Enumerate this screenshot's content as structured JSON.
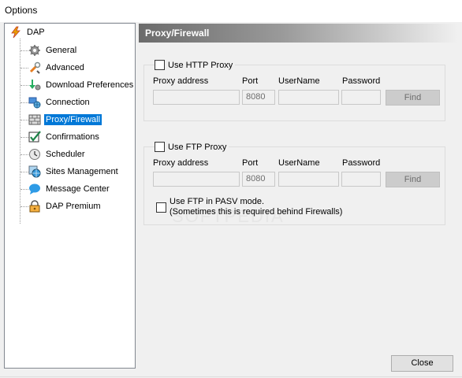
{
  "window": {
    "title": "Options"
  },
  "tree": {
    "root": {
      "label": "DAP",
      "icon": "dap-bolt-icon"
    },
    "items": [
      {
        "label": "General",
        "icon": "gear-icon"
      },
      {
        "label": "Advanced",
        "icon": "advanced-tools-icon"
      },
      {
        "label": "Download Preferences",
        "icon": "download-gear-icon"
      },
      {
        "label": "Connection",
        "icon": "connection-globe-icon"
      },
      {
        "label": "Proxy/Firewall",
        "icon": "firewall-wall-icon",
        "selected": true
      },
      {
        "label": "Confirmations",
        "icon": "checkmark-icon"
      },
      {
        "label": "Scheduler",
        "icon": "clock-icon"
      },
      {
        "label": "Sites Management",
        "icon": "sites-globe-icon"
      },
      {
        "label": "Message Center",
        "icon": "chat-bubble-icon"
      },
      {
        "label": "DAP Premium",
        "icon": "premium-lock-icon"
      }
    ]
  },
  "panel": {
    "title": "Proxy/Firewall",
    "http": {
      "checkbox_label": "Use HTTP Proxy",
      "proxy_address_label": "Proxy address",
      "port_label": "Port",
      "username_label": "UserName",
      "password_label": "Password",
      "proxy_address_value": "",
      "port_value": "8080",
      "username_value": "",
      "password_value": "",
      "find_label": "Find"
    },
    "ftp": {
      "checkbox_label": "Use FTP Proxy",
      "proxy_address_label": "Proxy address",
      "port_label": "Port",
      "username_label": "UserName",
      "password_label": "Password",
      "proxy_address_value": "",
      "port_value": "8080",
      "username_value": "",
      "password_value": "",
      "find_label": "Find",
      "pasv_line1": "Use FTP in PASV mode.",
      "pasv_line2": "(Sometimes this is required behind Firewalls)"
    }
  },
  "footer": {
    "close_label": "Close"
  },
  "watermark": "SOFTPEDIA",
  "colors": {
    "selection": "#0078d7",
    "header_dark": "#6b6b6b"
  }
}
